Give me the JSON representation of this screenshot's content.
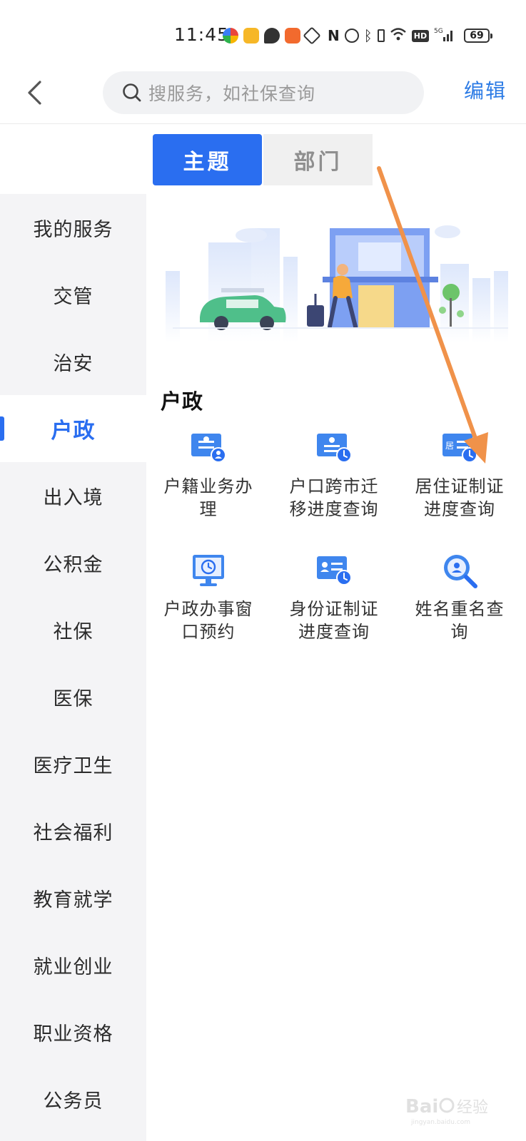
{
  "status_bar": {
    "time": "11:45",
    "battery": "69",
    "icons": [
      "app-icon-colorful",
      "app-icon-yellow",
      "message-icon",
      "app-icon-orange",
      "hand-icon",
      "nfc-icon",
      "alarm-icon",
      "bluetooth-icon",
      "battery-saver-icon",
      "wifi-icon",
      "hd-icon",
      "signal-icon"
    ]
  },
  "header": {
    "search_placeholder": "搜服务，如社保查询",
    "edit_label": "编辑"
  },
  "tabs": [
    {
      "label": "主题",
      "active": true
    },
    {
      "label": "部门",
      "active": false
    }
  ],
  "sidebar": {
    "items": [
      {
        "label": "我的服务"
      },
      {
        "label": "交管"
      },
      {
        "label": "治安"
      },
      {
        "label": "户政",
        "active": true
      },
      {
        "label": "出入境"
      },
      {
        "label": "公积金"
      },
      {
        "label": "社保"
      },
      {
        "label": "医保"
      },
      {
        "label": "医疗卫生"
      },
      {
        "label": "社会福利"
      },
      {
        "label": "教育就学"
      },
      {
        "label": "就业创业"
      },
      {
        "label": "职业资格"
      },
      {
        "label": "公务员"
      }
    ]
  },
  "section": {
    "title": "户政",
    "services": [
      {
        "line1": "户籍业务办",
        "line2": "理",
        "icon": "household-card-icon"
      },
      {
        "line1": "户口跨市迁",
        "line2": "移进度查询",
        "icon": "migration-progress-icon"
      },
      {
        "line1": "居住证制证",
        "line2": "进度查询",
        "icon": "residence-permit-icon"
      },
      {
        "line1": "户政办事窗",
        "line2": "口预约",
        "icon": "window-appointment-icon"
      },
      {
        "line1": "身份证制证",
        "line2": "进度查询",
        "icon": "id-card-progress-icon"
      },
      {
        "line1": "姓名重名查",
        "line2": "询",
        "icon": "name-search-icon"
      }
    ]
  },
  "colors": {
    "accent": "#2a6ef0",
    "link": "#2c7be5",
    "annotation_arrow": "#f0924a"
  },
  "watermark": {
    "text": "Bai 经验",
    "sub": "jingyan.baidu.com"
  }
}
